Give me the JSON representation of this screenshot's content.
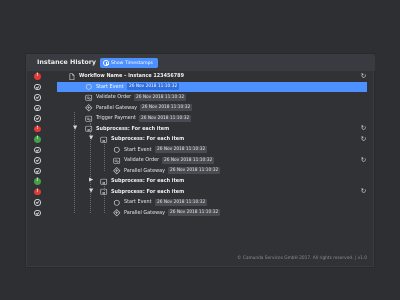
{
  "header": {
    "title": "Instance History",
    "timestamps_button": "Show Timestamps"
  },
  "colors": {
    "accent": "#4d90ff",
    "error": "#e53935",
    "success": "#43a047"
  },
  "rows": [
    {
      "status": "error",
      "caret": "",
      "icon": "document-icon",
      "label": "Workflow Name – Instance 123456789",
      "bold": true,
      "timestamp": "",
      "reload": true
    },
    {
      "status": "done",
      "caret": "",
      "icon": "start-event-icon",
      "label": "Start Event",
      "bold": false,
      "timestamp": "26 Nov 2018 11:10:32",
      "selected": true
    },
    {
      "status": "done",
      "caret": "",
      "icon": "service-task-icon",
      "label": "Validate Order",
      "bold": false,
      "timestamp": "26 Nov 2018 11:10:32"
    },
    {
      "status": "done",
      "caret": "",
      "icon": "gateway-icon",
      "label": "Parallel Gateway",
      "bold": false,
      "timestamp": "26 Nov 2018 11:10:32"
    },
    {
      "status": "done",
      "caret": "",
      "icon": "service-task-icon",
      "label": "Trigger Payment",
      "bold": false,
      "timestamp": "26 Nov 2018 11:10:32"
    },
    {
      "status": "error",
      "caret": "down",
      "icon": "subprocess-icon",
      "label": "Subprocess: For each item",
      "bold": true,
      "timestamp": "",
      "reload": true
    },
    {
      "status": "ok",
      "caret": "down",
      "icon": "subprocess-icon",
      "label": "Subprocess: For each item",
      "bold": true,
      "timestamp": "",
      "reload": true
    },
    {
      "status": "done",
      "caret": "",
      "icon": "start-event-icon",
      "label": "Start Event",
      "bold": false,
      "timestamp": "26 Nov 2018 11:10:32"
    },
    {
      "status": "done",
      "caret": "",
      "icon": "service-task-icon",
      "label": "Validate Order",
      "bold": false,
      "timestamp": "26 Nov 2018 11:10:32",
      "reload": true
    },
    {
      "status": "done",
      "caret": "",
      "icon": "gateway-icon",
      "label": "Parallel Gateway",
      "bold": false,
      "timestamp": "26 Nov 2018 11:10:32"
    },
    {
      "status": "ok",
      "caret": "right",
      "icon": "subprocess-icon",
      "label": "Subprocess: For each item",
      "bold": true,
      "timestamp": ""
    },
    {
      "status": "error",
      "caret": "down",
      "icon": "subprocess-icon",
      "label": "Subprocess: For each item",
      "bold": true,
      "timestamp": "",
      "reload": true
    },
    {
      "status": "done",
      "caret": "",
      "icon": "start-event-icon",
      "label": "Start Event",
      "bold": false,
      "timestamp": "26 Nov 2018 11:10:32"
    },
    {
      "status": "done",
      "caret": "",
      "icon": "gateway-icon",
      "label": "Parallel Gateway",
      "bold": false,
      "timestamp": "26 Nov 2018 11:10:32"
    }
  ],
  "footer": "© Camunda Services GmbH 2017. All rights reserved. | v1.0"
}
